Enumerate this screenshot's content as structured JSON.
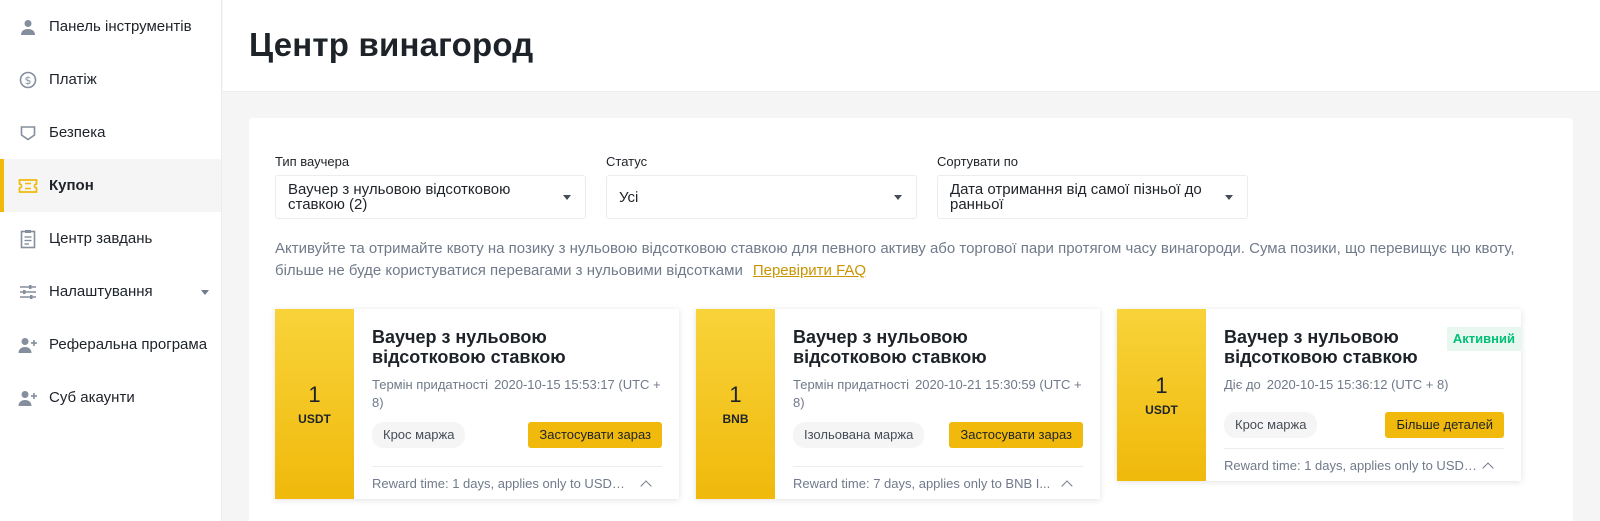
{
  "sidebar": {
    "items": [
      {
        "label": "Панель інструментів",
        "icon": "user-icon"
      },
      {
        "label": "Платіж",
        "icon": "dollar-icon"
      },
      {
        "label": "Безпека",
        "icon": "shield-icon"
      },
      {
        "label": "Купон",
        "icon": "ticket-icon",
        "active": true
      },
      {
        "label": "Центр завдань",
        "icon": "clipboard-icon"
      },
      {
        "label": "Налаштування",
        "icon": "sliders-icon",
        "has_submenu": true
      },
      {
        "label": "Реферальна програма",
        "icon": "user-plus-icon"
      },
      {
        "label": "Суб акаунти",
        "icon": "user-plus-icon"
      }
    ]
  },
  "header": {
    "title": "Центр винагород"
  },
  "filters": {
    "voucher_type": {
      "label": "Тип ваучера",
      "value": "Ваучер з нульовою відсотковою ставкою (2)"
    },
    "status": {
      "label": "Статус",
      "value": "Усі"
    },
    "sort": {
      "label": "Сортувати по",
      "value": "Дата отримання від самої пізньої до ранньої"
    }
  },
  "info": {
    "text": "Активуйте та отримайте квоту на позику з нульовою відсотковою ставкою для певного активу або торгової пари протягом часу винагороди. Сума позики, що перевищує цю квоту, більше не буде користуватися перевагами з нульовими відсотками",
    "faq_link": "Перевірити FAQ"
  },
  "cards": [
    {
      "amount": "1",
      "currency": "USDT",
      "title": "Ваучер з нульовою відсотковою ставкою",
      "expiry_label": "Термін придатності",
      "expiry_value": "2020-10-15 15:53:17 (UTC + 8)",
      "tag": "Крос маржа",
      "button": "Застосувати зараз",
      "footer": "Reward time: 1 days, applies only to USDT ...",
      "badge": ""
    },
    {
      "amount": "1",
      "currency": "BNB",
      "title": "Ваучер з нульовою відсотковою ставкою",
      "expiry_label": "Термін придатності",
      "expiry_value": "2020-10-21 15:30:59 (UTC + 8)",
      "tag": "Ізольована маржа",
      "button": "Застосувати зараз",
      "footer": "Reward time: 7 days, applies only to BNB I...",
      "badge": ""
    },
    {
      "amount": "1",
      "currency": "USDT",
      "title": "Ваучер з нульовою відсотковою ставкою",
      "expiry_label": "Діє до",
      "expiry_value": "2020-10-15 15:36:12 (UTC + 8)",
      "tag": "Крос маржа",
      "button": "Більше деталей",
      "footer": "Reward time: 1 days, applies only to USDT ...",
      "badge": "Активний"
    }
  ],
  "colors": {
    "accent": "#f0b90b",
    "accent_light": "#f8d33a",
    "link": "#c99400",
    "active_badge_text": "#02c076",
    "active_badge_bg": "#e8f8f0",
    "muted_text": "#707a8a"
  }
}
